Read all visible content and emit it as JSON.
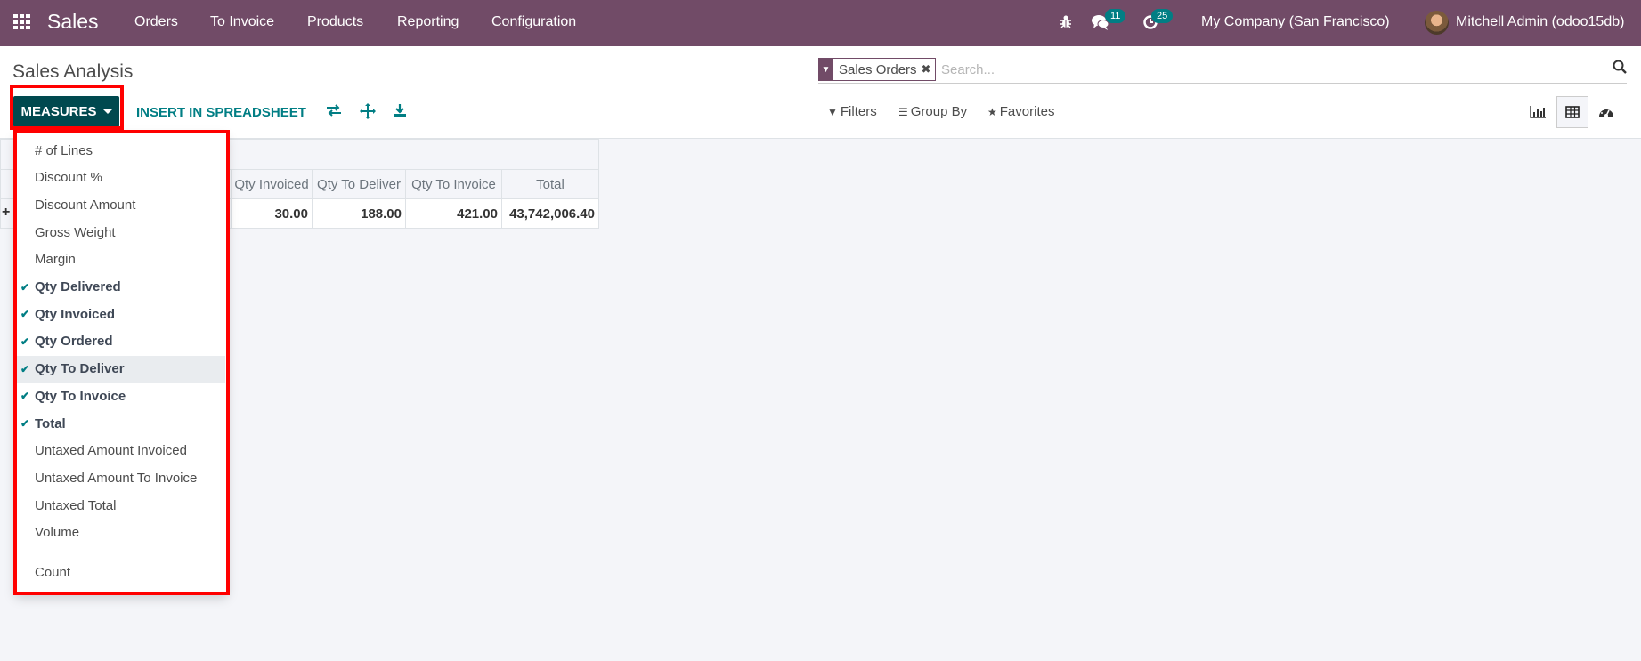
{
  "navbar": {
    "app_name": "Sales",
    "menu": [
      "Orders",
      "To Invoice",
      "Products",
      "Reporting",
      "Configuration"
    ],
    "systray": {
      "debug_icon": "bug-icon",
      "messages_icon": "chat-icon",
      "messages_count": "11",
      "activities_icon": "clock-icon",
      "activities_count": "25"
    },
    "company": "My Company (San Francisco)",
    "user": "Mitchell Admin (odoo15db)"
  },
  "control_panel": {
    "title": "Sales Analysis",
    "measures_label": "MEASURES",
    "insert_label": "INSERT IN SPREADSHEET",
    "tool_icons": [
      "flip-axis-icon",
      "expand-all-icon",
      "download-icon"
    ],
    "search": {
      "facet_icon": "filter-icon",
      "facet_value": "Sales Orders",
      "placeholder": "Search..."
    },
    "filters_label": "Filters",
    "groupby_label": "Group By",
    "favorites_label": "Favorites",
    "views": [
      {
        "name": "graph",
        "icon": "bar-chart-icon",
        "active": false
      },
      {
        "name": "pivot",
        "icon": "table-icon",
        "active": true
      },
      {
        "name": "dashboard",
        "icon": "dashboard-icon",
        "active": false
      }
    ]
  },
  "pivot": {
    "columns": [
      "Qty Invoiced",
      "Qty To Deliver",
      "Qty To Invoice",
      "Total"
    ],
    "totals": [
      "30.00",
      "188.00",
      "421.00",
      "43,742,006.40"
    ],
    "row_expand_symbol": "+"
  },
  "measures_menu": {
    "items": [
      {
        "label": "# of Lines",
        "selected": false
      },
      {
        "label": "Discount %",
        "selected": false
      },
      {
        "label": "Discount Amount",
        "selected": false
      },
      {
        "label": "Gross Weight",
        "selected": false
      },
      {
        "label": "Margin",
        "selected": false
      },
      {
        "label": "Qty Delivered",
        "selected": true
      },
      {
        "label": "Qty Invoiced",
        "selected": true
      },
      {
        "label": "Qty Ordered",
        "selected": true
      },
      {
        "label": "Qty To Deliver",
        "selected": true,
        "hover": true
      },
      {
        "label": "Qty To Invoice",
        "selected": true
      },
      {
        "label": "Total",
        "selected": true
      },
      {
        "label": "Untaxed Amount Invoiced",
        "selected": false
      },
      {
        "label": "Untaxed Amount To Invoice",
        "selected": false
      },
      {
        "label": "Untaxed Total",
        "selected": false
      },
      {
        "label": "Volume",
        "selected": false
      }
    ],
    "count_label": "Count",
    "check_symbol": "✔"
  },
  "colors": {
    "navbar": "#714b67",
    "primary_button": "#00494f",
    "accent": "#017e84",
    "highlight": "#ff0000"
  }
}
